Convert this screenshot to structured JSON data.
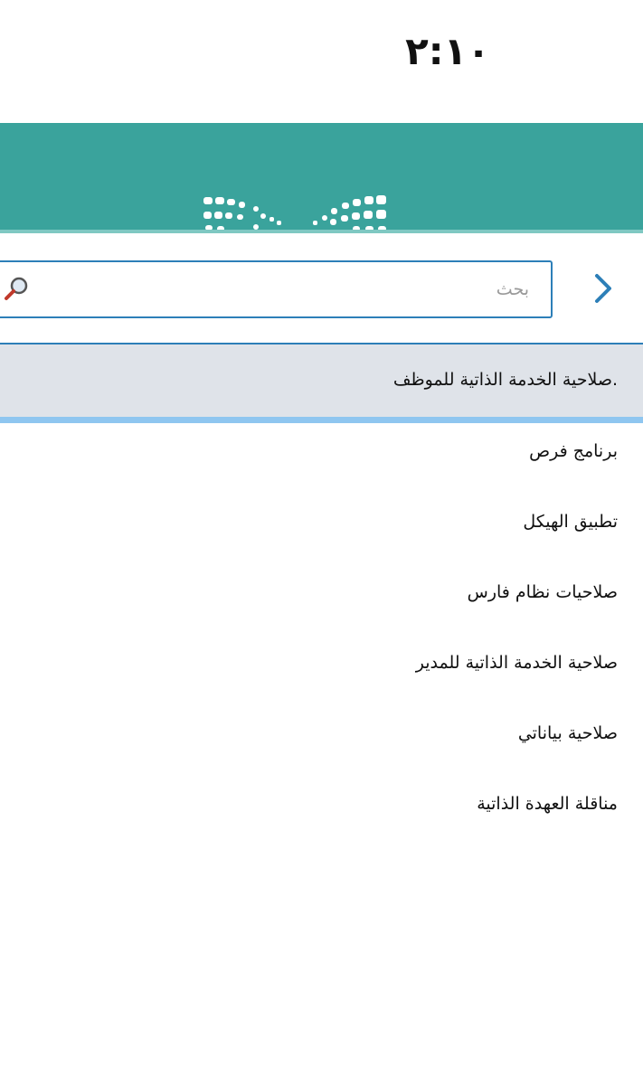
{
  "status_bar": {
    "time": "٢:١٠"
  },
  "header": {
    "logo": "ministry-logo"
  },
  "search": {
    "placeholder": "بحث",
    "value": ""
  },
  "nav": {
    "back_icon": "chevron-right-icon"
  },
  "selected_item": {
    "label": ".صلاحية الخدمة الذاتية للموظف"
  },
  "menu": {
    "items": [
      {
        "label": "برنامج فرص"
      },
      {
        "label": "تطبيق الهيكل"
      },
      {
        "label": "صلاحيات نظام فارس"
      },
      {
        "label": "صلاحية الخدمة الذاتية للمدير"
      },
      {
        "label": "صلاحية بياناتي"
      },
      {
        "label": "مناقلة العهدة الذاتية"
      }
    ]
  },
  "colors": {
    "header_bg": "#3aa39c",
    "accent_blue": "#2d7fb8",
    "selected_bg": "#dfe3e9",
    "selected_underline": "#8fc6f0"
  }
}
